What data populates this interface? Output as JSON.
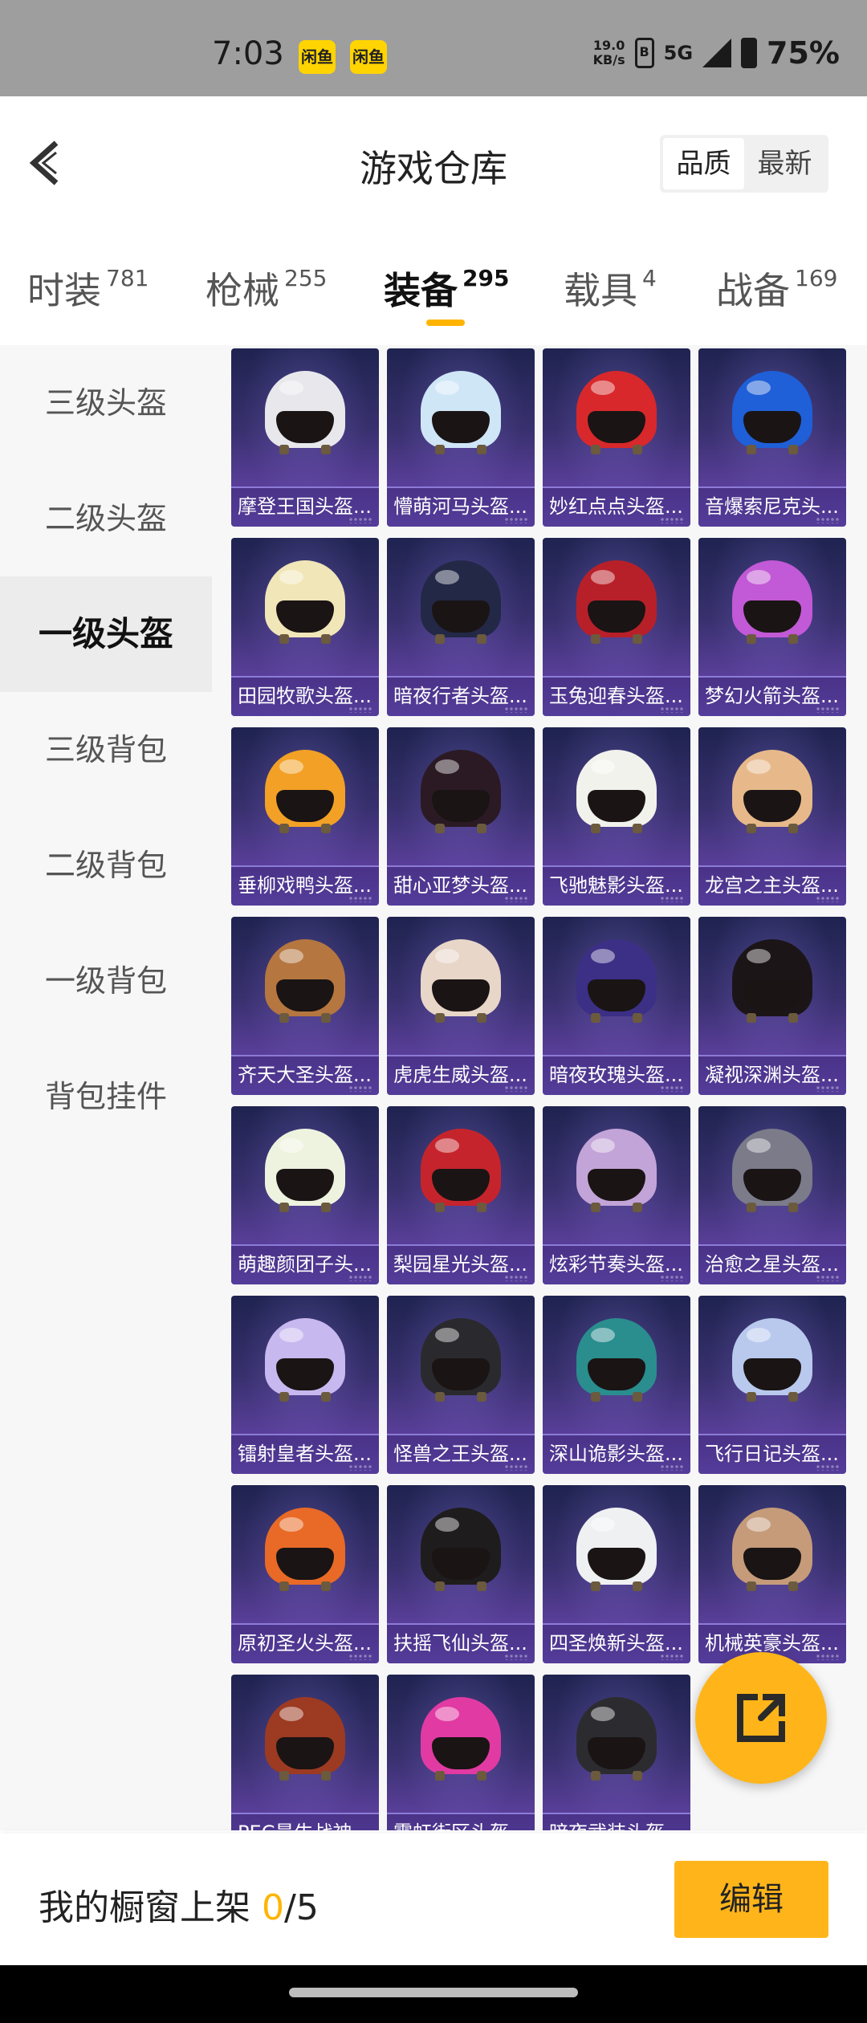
{
  "status_bar": {
    "time": "7:03",
    "app_badge": "闲鱼",
    "speed_value": "19.0",
    "speed_unit": "KB/s",
    "network_box": "B",
    "network": "5G",
    "battery": "75%"
  },
  "header": {
    "title": "游戏仓库",
    "sort_options": [
      "品质",
      "最新"
    ],
    "sort_active": "品质"
  },
  "tabs": [
    {
      "label": "时装",
      "count": "781"
    },
    {
      "label": "枪械",
      "count": "255"
    },
    {
      "label": "装备",
      "count": "295",
      "active": true
    },
    {
      "label": "载具",
      "count": "4"
    },
    {
      "label": "战备",
      "count": "169"
    }
  ],
  "sidebar": {
    "items": [
      "三级头盔",
      "二级头盔",
      "一级头盔",
      "三级背包",
      "二级背包",
      "一级背包",
      "背包挂件"
    ],
    "active_index": 2
  },
  "items": [
    {
      "name": "摩登王国头盔...",
      "color": "#e8e8ec"
    },
    {
      "name": "懵萌河马头盔...",
      "color": "#cfe6f7"
    },
    {
      "name": "妙红点点头盔...",
      "color": "#d8282b"
    },
    {
      "name": "音爆索尼克头...",
      "color": "#1f5fd8"
    },
    {
      "name": "田园牧歌头盔...",
      "color": "#f1e6b8"
    },
    {
      "name": "暗夜行者头盔...",
      "color": "#232847"
    },
    {
      "name": "玉兔迎春头盔...",
      "color": "#b82029"
    },
    {
      "name": "梦幻火箭头盔...",
      "color": "#c259d6"
    },
    {
      "name": "垂柳戏鸭头盔...",
      "color": "#f2a126"
    },
    {
      "name": "甜心亚梦头盔...",
      "color": "#2b1a24"
    },
    {
      "name": "飞驰魅影头盔...",
      "color": "#f2f2ec"
    },
    {
      "name": "龙宫之主头盔...",
      "color": "#e7b98a"
    },
    {
      "name": "齐天大圣头盔...",
      "color": "#b5763f"
    },
    {
      "name": "虎虎生威头盔...",
      "color": "#e8d6c8"
    },
    {
      "name": "暗夜玫瑰头盔...",
      "color": "#3c2f86"
    },
    {
      "name": "凝视深渊头盔...",
      "color": "#1c1518"
    },
    {
      "name": "萌趣颜团子头...",
      "color": "#eef3e0"
    },
    {
      "name": "梨园星光头盔...",
      "color": "#c6242c"
    },
    {
      "name": "炫彩节奏头盔...",
      "color": "#c3a4d8"
    },
    {
      "name": "治愈之星头盔...",
      "color": "#7b7b8a"
    },
    {
      "name": "镭射皇者头盔...",
      "color": "#c7b8ef"
    },
    {
      "name": "怪兽之王头盔...",
      "color": "#2a2a2e"
    },
    {
      "name": "深山诡影头盔...",
      "color": "#2a8d8e"
    },
    {
      "name": "飞行日记头盔...",
      "color": "#b9c9ee"
    },
    {
      "name": "原初圣火头盔...",
      "color": "#e86a26"
    },
    {
      "name": "扶摇飞仙头盔...",
      "color": "#1f1c1d"
    },
    {
      "name": "四圣焕新头盔...",
      "color": "#eef0f2"
    },
    {
      "name": "机械英豪头盔...",
      "color": "#c59b7a"
    },
    {
      "name": "PEC最牛战神...",
      "color": "#9c3a22"
    },
    {
      "name": "霓虹街区头盔...",
      "color": "#e23aa3"
    },
    {
      "name": "暗夜武装头盔...",
      "color": "#2c2c30"
    }
  ],
  "bottom": {
    "label": "我的橱窗上架",
    "current": "0",
    "total": "/5",
    "edit_label": "编辑"
  },
  "colors": {
    "accent": "#ffb51a",
    "card_top": "#1f2350",
    "card_bottom": "#7256c4"
  }
}
